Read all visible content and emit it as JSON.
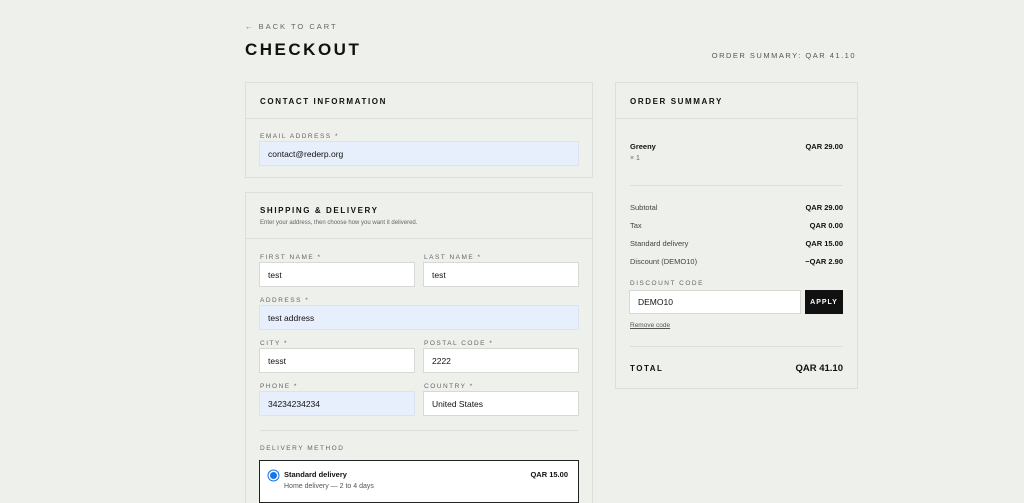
{
  "header": {
    "back_link": "← BACK TO CART",
    "title": "CHECKOUT",
    "summary_label": "ORDER SUMMARY: QAR 41.10"
  },
  "contact": {
    "heading": "CONTACT INFORMATION",
    "email_label": "EMAIL ADDRESS *",
    "email_value": "contact@rederp.org"
  },
  "shipping": {
    "heading": "SHIPPING & DELIVERY",
    "subtitle": "Enter your address, then choose how you want it delivered.",
    "first_name_label": "FIRST NAME *",
    "first_name_value": "test",
    "last_name_label": "LAST NAME *",
    "last_name_value": "test",
    "address_label": "ADDRESS *",
    "address_value": "test address",
    "city_label": "CITY *",
    "city_value": "tesst",
    "postal_label": "POSTAL CODE *",
    "postal_value": "2222",
    "phone_label": "PHONE *",
    "phone_value": "34234234234",
    "country_label": "COUNTRY *",
    "country_value": "United States",
    "delivery_method_label": "DELIVERY METHOD",
    "delivery_option": {
      "name": "Standard delivery",
      "price": "QAR 15.00",
      "description": "Home delivery — 2 to 4 days",
      "selected": true
    }
  },
  "order_summary": {
    "heading": "ORDER SUMMARY",
    "item": {
      "name": "Greeny",
      "qty": "× 1",
      "price": "QAR 29.00"
    },
    "lines": [
      {
        "label": "Subtotal",
        "value": "QAR 29.00"
      },
      {
        "label": "Tax",
        "value": "QAR 0.00"
      },
      {
        "label": "Standard delivery",
        "value": "QAR 15.00"
      },
      {
        "label": "Discount (DEMO10)",
        "value": "−QAR 2.90"
      }
    ],
    "discount_label": "DISCOUNT CODE",
    "discount_value": "DEMO10",
    "apply_label": "APPLY",
    "remove_label": "Remove code",
    "total_label": "TOTAL",
    "total_value": "QAR 41.10"
  },
  "colors": {
    "accent": "#111111",
    "autofill": "#e8effc",
    "background": "#eef0ec",
    "radio": "#1a73e8"
  }
}
